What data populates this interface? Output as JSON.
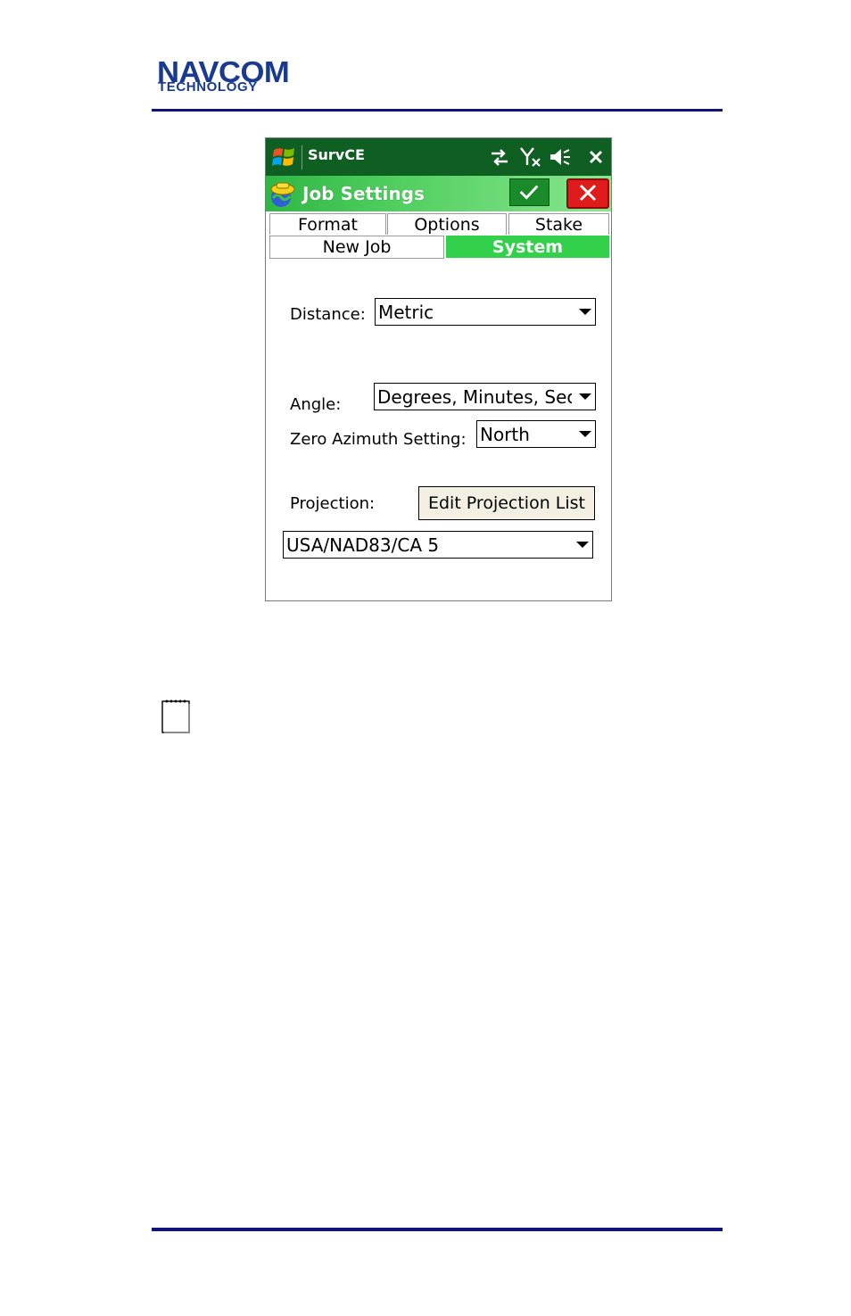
{
  "document": {
    "logo_line1": "NAVCOM",
    "logo_line2": "TECHNOLOGY"
  },
  "taskbar": {
    "app_name": "SurvCE",
    "icons": [
      "start-flag-icon",
      "connectivity-icon",
      "no-signal-icon",
      "speaker-muted-icon",
      "close-icon"
    ]
  },
  "titlebar": {
    "title": "Job Settings",
    "ok_icon": "checkmark-icon",
    "cancel_icon": "close-icon"
  },
  "tabs": {
    "row1": [
      "Format",
      "Options",
      "Stake"
    ],
    "row2": [
      "New Job",
      "System"
    ],
    "active": "System"
  },
  "form": {
    "distance_label": "Distance:",
    "distance_value": "Metric",
    "angle_label": "Angle:",
    "angle_value": "Degrees, Minutes, Secc",
    "zero_azimuth_label": "Zero Azimuth Setting:",
    "zero_azimuth_value": "North",
    "projection_label": "Projection:",
    "edit_projection_button": "Edit Projection List",
    "projection_value": "USA/NAD83/CA 5"
  },
  "colors": {
    "taskbar": "#0f5e22",
    "title_gradient_start": "#2fb744",
    "active_tab": "#32d04b",
    "ok_button": "#1b8a2a",
    "cancel_button": "#e01b1b",
    "rule": "#12127a",
    "logo": "#1a3a8f"
  }
}
